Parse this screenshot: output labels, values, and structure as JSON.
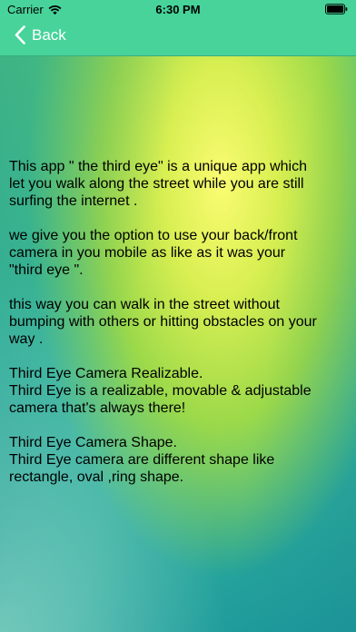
{
  "status_bar": {
    "carrier": "Carrier",
    "time": "6:30 PM"
  },
  "nav": {
    "back_label": "Back"
  },
  "content": {
    "paragraphs": [
      "This app \" the third eye\" is a  unique app which\nlet you walk along the street while you are still\nsurfing the internet .",
      "we give you the option to use your back/front\ncamera in you mobile as like as it was your\n\"third eye \".",
      "this way you can walk in the street without\nbumping with others or hitting obstacles on your\nway .",
      "Third Eye Camera Realizable.\nThird Eye is a realizable, movable & adjustable\ncamera that's always there!",
      "Third Eye Camera Shape.\nThird Eye camera are different shape like\nrectangle, oval ,ring shape."
    ]
  },
  "colors": {
    "bar_background": "#47d39a",
    "back_text": "#ffffff"
  },
  "icons": [
    "wifi-icon",
    "battery-icon",
    "chevron-left-icon"
  ]
}
